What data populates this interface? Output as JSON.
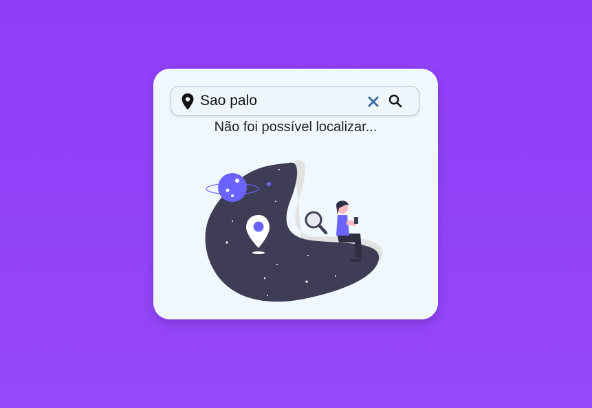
{
  "search": {
    "value": "Sao palo",
    "icons": {
      "left": "map-pin-icon",
      "clear": "close-icon",
      "submit": "search-icon"
    },
    "clear_color": "#3a6aa8"
  },
  "message": "Não foi possível localizar...",
  "colors": {
    "background": "#9343f7",
    "card": "#f0f7fd",
    "blob": "#3f3d56",
    "accent": "#6c63ff"
  },
  "illustration": {
    "name": "not-found-illustration"
  }
}
